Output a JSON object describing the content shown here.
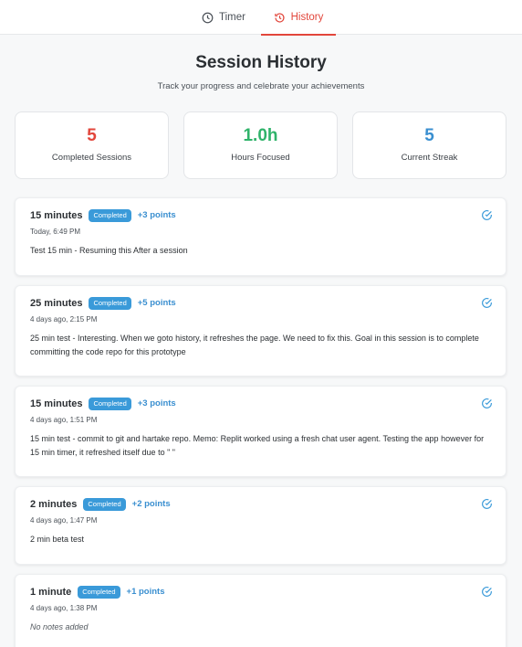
{
  "nav": {
    "tabs": [
      {
        "label": "Timer",
        "icon": "clock-icon",
        "active": false
      },
      {
        "label": "History",
        "icon": "history-icon",
        "active": true
      }
    ]
  },
  "header": {
    "title": "Session History",
    "subtitle": "Track your progress and celebrate your achievements"
  },
  "stats": [
    {
      "value": "5",
      "label": "Completed Sessions",
      "color": "#e2463b"
    },
    {
      "value": "1.0h",
      "label": "Hours Focused",
      "color": "#2fb36a"
    },
    {
      "value": "5",
      "label": "Current Streak",
      "color": "#3a8fd0"
    }
  ],
  "sessions": [
    {
      "duration": "15 minutes",
      "badge": "Completed",
      "points": "+3 points",
      "when": "Today, 6:49 PM",
      "note": "Test 15 min - Resuming this After a session",
      "empty": false
    },
    {
      "duration": "25 minutes",
      "badge": "Completed",
      "points": "+5 points",
      "when": "4 days ago, 2:15 PM",
      "note": "25 min test - Interesting. When we goto history, it refreshes the page. We need to fix this. Goal in this session is to complete committing the code repo for this prototype",
      "empty": false
    },
    {
      "duration": "15 minutes",
      "badge": "Completed",
      "points": "+3 points",
      "when": "4 days ago, 1:51 PM",
      "note": "15 min test - commit to git and hartake repo. Memo: Replit worked using a fresh chat user agent. Testing the app however for 15 min timer, it refreshed itself due to \" \"",
      "empty": false
    },
    {
      "duration": "2 minutes",
      "badge": "Completed",
      "points": "+2 points",
      "when": "4 days ago, 1:47 PM",
      "note": "2 min beta test",
      "empty": false
    },
    {
      "duration": "1 minute",
      "badge": "Completed",
      "points": "+1 points",
      "when": "4 days ago, 1:38 PM",
      "note": "No notes added",
      "empty": true
    }
  ],
  "colors": {
    "accent": "#e2463b",
    "badge": "#3a9ad9",
    "points": "#3a8fd0",
    "check": "#3a9ad9"
  }
}
